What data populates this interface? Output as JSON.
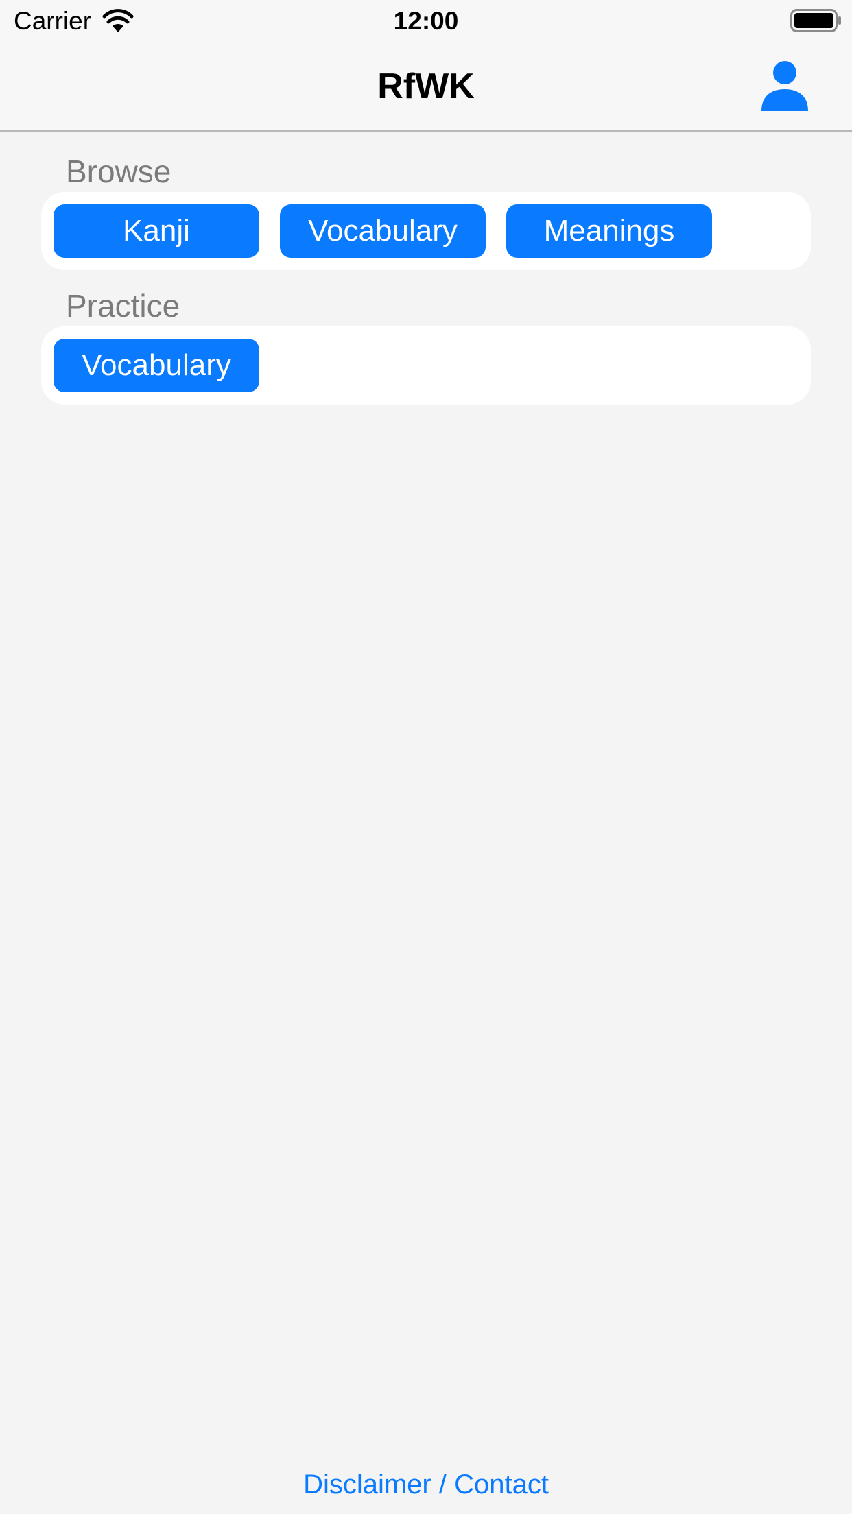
{
  "status_bar": {
    "carrier": "Carrier",
    "time": "12:00",
    "wifi_icon": "wifi-icon",
    "battery_icon": "battery-full-icon"
  },
  "nav": {
    "title": "RfWK",
    "profile_icon": "person-icon"
  },
  "browse": {
    "header": "Browse",
    "buttons": [
      "Kanji",
      "Vocabulary",
      "Meanings"
    ]
  },
  "practice": {
    "header": "Practice",
    "buttons": [
      "Vocabulary"
    ]
  },
  "footer": {
    "link": "Disclaimer / Contact"
  },
  "colors": {
    "accent": "#0a7aff",
    "background": "#f4f4f4",
    "card": "#ffffff",
    "section_header": "#7b7b7b"
  }
}
